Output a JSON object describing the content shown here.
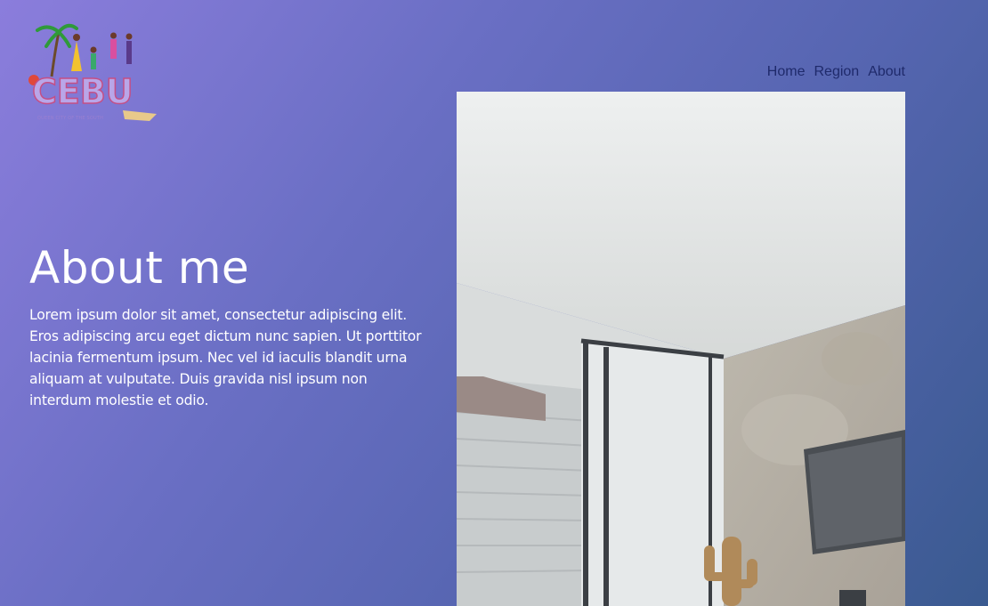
{
  "logo": {
    "alt": "CEBU",
    "wordmark": "CEBU",
    "tagline": "QUEEN CITY OF THE SOUTH"
  },
  "nav": {
    "items": [
      "Home",
      "Region",
      "About"
    ]
  },
  "about": {
    "heading": "About me",
    "body": "Lorem ipsum dolor sit amet, consectetur adipiscing elit. Eros adipiscing arcu eget dictum nunc sapien. Ut porttitor lacinia fermentum ipsum. Nec vel id iaculis blandit urna aliquam at vulputate. Duis gravida nisl ipsum non interdum molestie et odio."
  },
  "photo": {
    "alt": "Interior room with window, wall-mounted TV and cactus decor"
  },
  "colors": {
    "nav_link": "#1f2a6b",
    "heading": "#ffffff",
    "gradient_start": "#8b7ddc",
    "gradient_end": "#3a5a90"
  }
}
